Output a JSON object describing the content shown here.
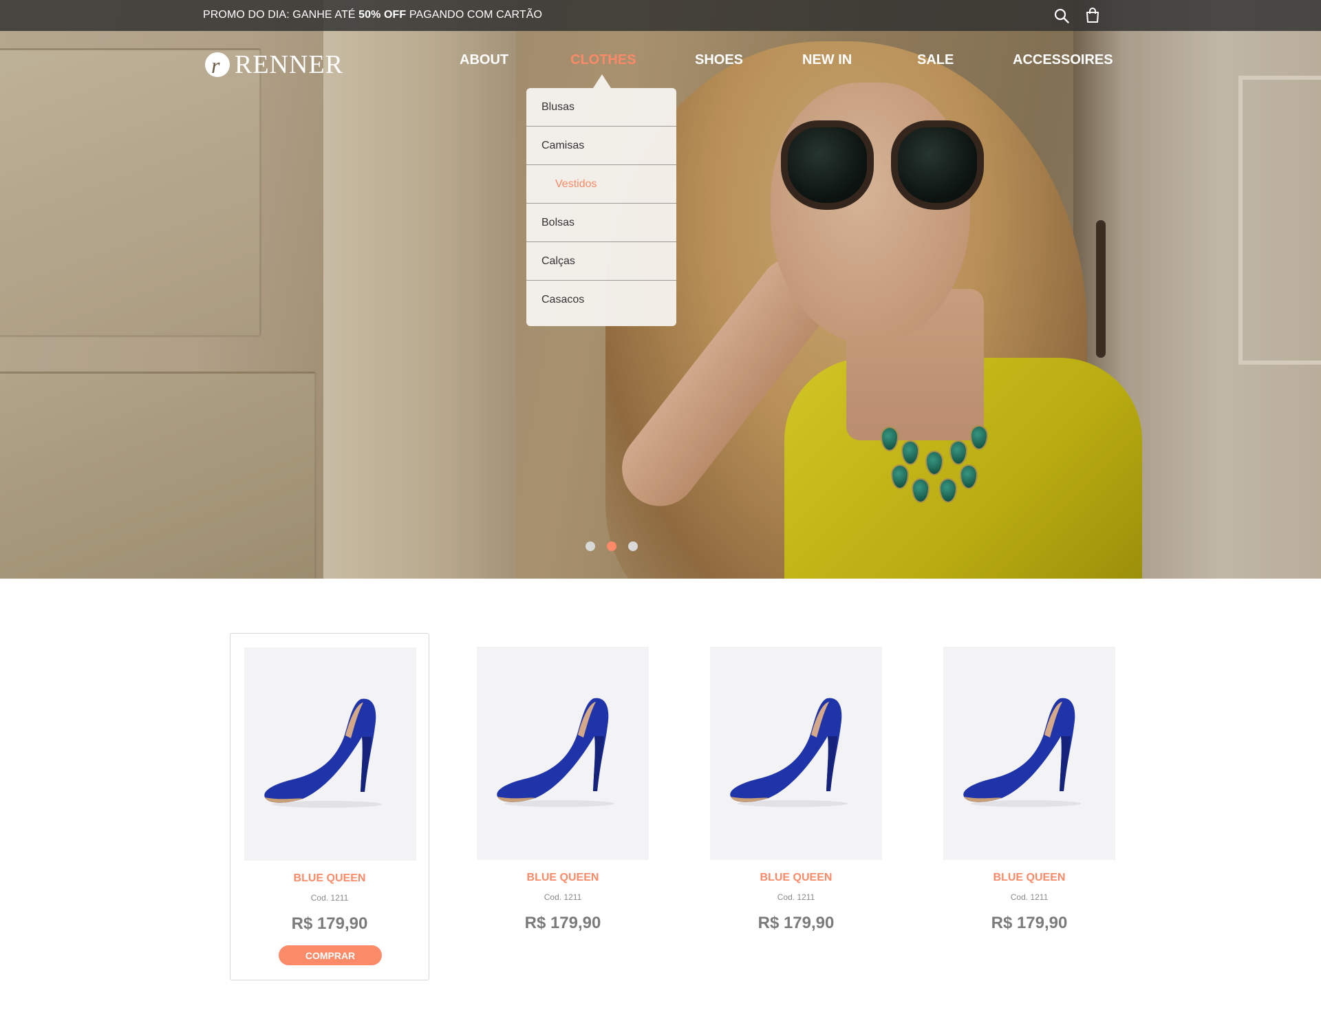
{
  "topbar": {
    "promo_prefix": "PROMO DO DIA: GANHE ATÉ ",
    "promo_highlight": "50% OFF",
    "promo_suffix": " PAGANDO COM CARTÃO",
    "icons": [
      "search-icon",
      "shopping-bag-icon"
    ]
  },
  "brand": {
    "logo_mark": "r",
    "logo_text": "RENNER"
  },
  "nav": {
    "items": [
      {
        "label": "ABOUT",
        "active": false
      },
      {
        "label": "CLOTHES",
        "active": true
      },
      {
        "label": "SHOES",
        "active": false
      },
      {
        "label": "NEW IN",
        "active": false
      },
      {
        "label": "SALE",
        "active": false
      },
      {
        "label": "ACCESSOIRES",
        "active": false
      }
    ]
  },
  "dropdown": {
    "items": [
      {
        "label": "Blusas",
        "active": false
      },
      {
        "label": "Camisas",
        "active": false
      },
      {
        "label": "Vestidos",
        "active": true
      },
      {
        "label": "Bolsas",
        "active": false
      },
      {
        "label": "Calças",
        "active": false
      },
      {
        "label": "Casacos",
        "active": false
      }
    ]
  },
  "carousel": {
    "slides": 3,
    "active_index": 1
  },
  "products": [
    {
      "name": "BLUE QUEEN",
      "code": "Cod. 1211",
      "price": "R$ 179,90",
      "button": "COMPRAR",
      "selected": true
    },
    {
      "name": "BLUE QUEEN",
      "code": "Cod. 1211",
      "price": "R$ 179,90",
      "selected": false
    },
    {
      "name": "BLUE QUEEN",
      "code": "Cod. 1211",
      "price": "R$ 179,90",
      "selected": false
    },
    {
      "name": "BLUE QUEEN",
      "code": "Cod. 1211",
      "price": "R$ 179,90",
      "selected": false
    }
  ],
  "colors": {
    "accent": "#fb8a68",
    "topbar_bg": "#303030",
    "product_bg": "#f3f3f5",
    "shoe_blue": "#1f34a8"
  }
}
